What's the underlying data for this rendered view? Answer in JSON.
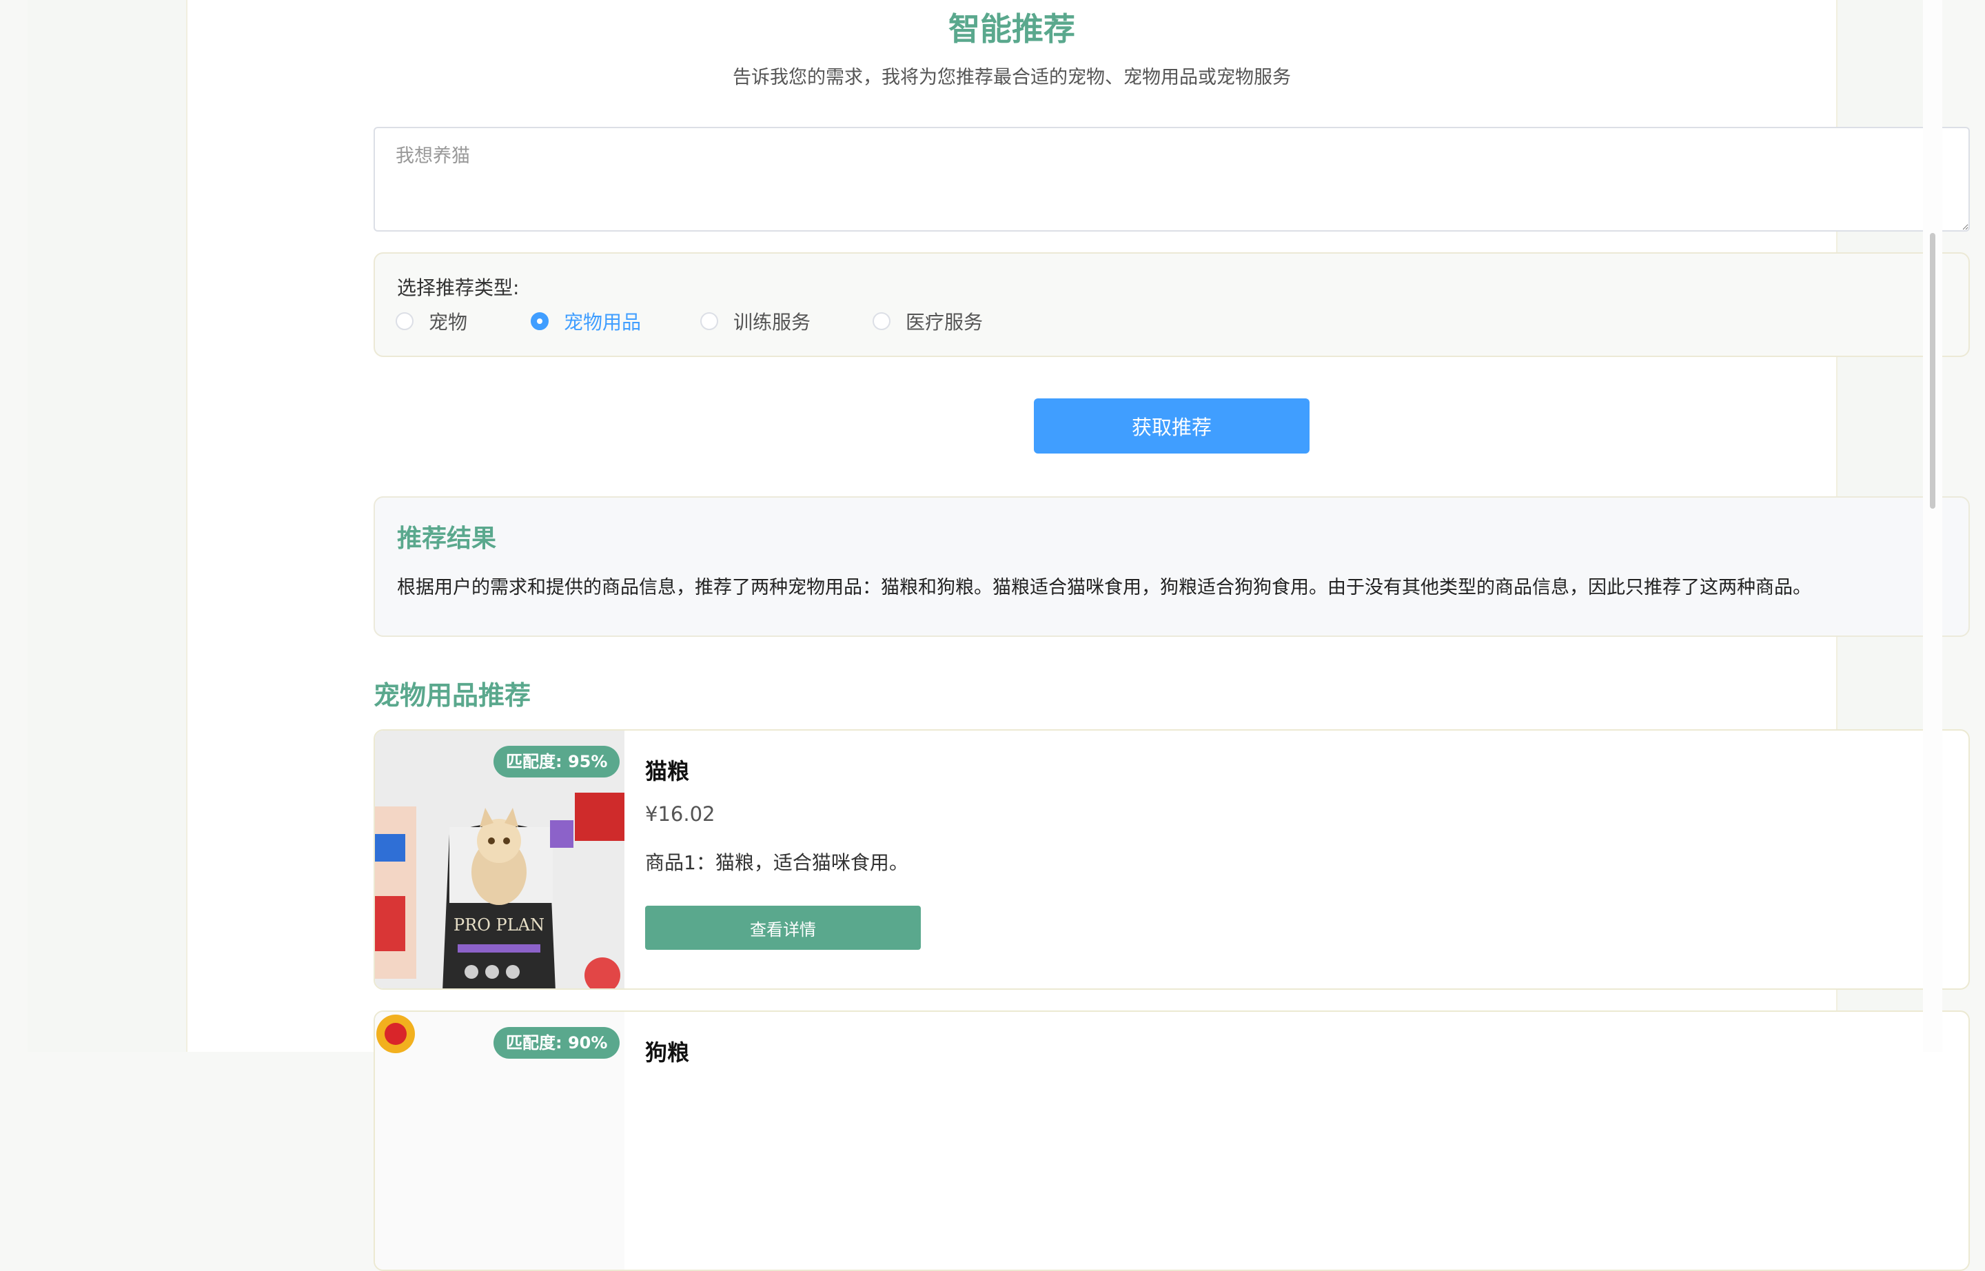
{
  "header": {
    "title": "智能推荐",
    "subtitle": "告诉我您的需求，我将为您推荐最合适的宠物、宠物用品或宠物服务"
  },
  "request": {
    "value": "",
    "placeholder": "我想养猫"
  },
  "type_selector": {
    "label": "选择推荐类型:",
    "options": [
      {
        "label": "宠物",
        "checked": false
      },
      {
        "label": "宠物用品",
        "checked": true
      },
      {
        "label": "训练服务",
        "checked": false
      },
      {
        "label": "医疗服务",
        "checked": false
      }
    ]
  },
  "submit_label": "获取推荐",
  "result": {
    "title": "推荐结果",
    "text": "根据用户的需求和提供的商品信息，推荐了两种宠物用品：猫粮和狗粮。猫粮适合猫咪食用，狗粮适合狗狗食用。由于没有其他类型的商品信息，因此只推荐了这两种商品。"
  },
  "products_section": {
    "title": "宠物用品推荐",
    "items": [
      {
        "badge": "匹配度: 95%",
        "name": "猫粮",
        "price": "¥16.02",
        "desc": "商品1：猫粮，适合猫咪食用。",
        "button": "查看详情",
        "image_icon": "cat-food-bag-image",
        "image_logo": "PRO PLAN"
      },
      {
        "badge": "匹配度: 90%",
        "name": "狗粮",
        "image_icon": "dog-food-image"
      }
    ]
  },
  "colors": {
    "accent_green": "#5aa88d",
    "primary_blue": "#409eff"
  }
}
